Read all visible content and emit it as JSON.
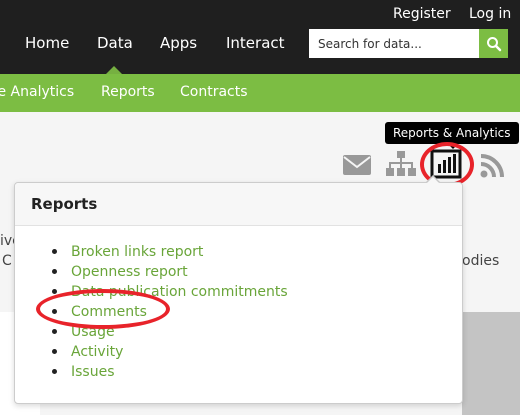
{
  "header": {
    "register_label": "Register",
    "login_label": "Log in",
    "nav": [
      "Home",
      "Data",
      "Apps",
      "Interact"
    ],
    "search_placeholder": "Search for data...",
    "search_icon": "search-icon"
  },
  "subnav": {
    "items": [
      "te Analytics",
      "Reports",
      "Contracts"
    ]
  },
  "toolbar": {
    "tooltip": "Reports & Analytics",
    "icons": [
      "mail-icon",
      "sitemap-icon",
      "bar-chart-icon",
      "rss-icon"
    ]
  },
  "background_text": {
    "frag_ive": "ive",
    "frag_c": "C",
    "frag_odies": "odies"
  },
  "popover": {
    "title": "Reports",
    "items": [
      "Broken links report",
      "Openness report",
      "Data publication commitments",
      "Comments",
      "Usage",
      "Activity",
      "Issues"
    ]
  },
  "colors": {
    "accent_green": "#7cbd43",
    "link_green": "#69a539",
    "highlight_red": "#e8232a",
    "topbar": "#1f1f1f"
  }
}
